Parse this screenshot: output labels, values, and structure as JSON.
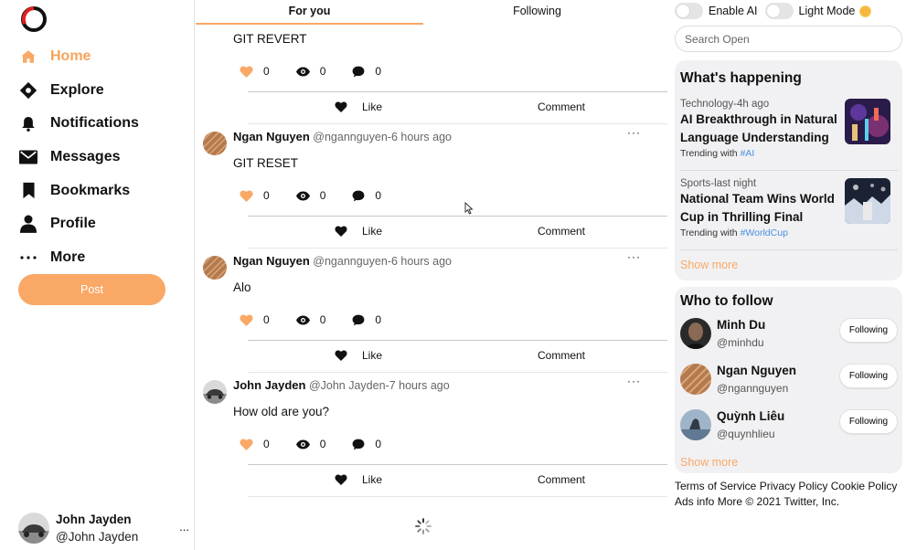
{
  "sidebar": {
    "items": [
      {
        "label": "Home",
        "icon": "home-icon"
      },
      {
        "label": "Explore",
        "icon": "explore-icon"
      },
      {
        "label": "Notifications",
        "icon": "bell-icon"
      },
      {
        "label": "Messages",
        "icon": "envelope-icon"
      },
      {
        "label": "Bookmarks",
        "icon": "bookmark-icon"
      },
      {
        "label": "Profile",
        "icon": "person-icon"
      },
      {
        "label": "More",
        "icon": "more-dots-icon"
      }
    ],
    "post_label": "Post",
    "user": {
      "name": "John Jayden",
      "handle": "@John Jayden",
      "menu": "..."
    }
  },
  "tabs": [
    "For you",
    "Following"
  ],
  "partial_post": {
    "text": "GIT REVERT",
    "likes": "0",
    "views": "0",
    "comments": "0"
  },
  "posts": [
    {
      "name": "Ngan Nguyen",
      "meta": "@ngannguyen-6 hours ago",
      "text": "GIT RESET",
      "likes": "0",
      "views": "0",
      "comments": "0"
    },
    {
      "name": "Ngan Nguyen",
      "meta": "@ngannguyen-6 hours ago",
      "text": "Alo",
      "likes": "0",
      "views": "0",
      "comments": "0"
    },
    {
      "name": "John Jayden",
      "meta": "@John Jayden-7 hours ago",
      "text": "How old are you?",
      "likes": "0",
      "views": "0",
      "comments": "0"
    }
  ],
  "post_actions": {
    "like": "Like",
    "comment": "Comment",
    "more": "···"
  },
  "right": {
    "toggles": {
      "ai": "Enable AI",
      "light": "Light Mode"
    },
    "search_placeholder": "Search Open",
    "happening": {
      "title": "What's happening",
      "trends": [
        {
          "meta": "Technology-4h ago",
          "title": "AI Breakthrough in Natural Language Understanding",
          "trending_prefix": "Trending with",
          "tag": "#AI"
        },
        {
          "meta": "Sports-last night",
          "title": "National Team Wins World Cup in Thrilling Final",
          "trending_prefix": "Trending with",
          "tag": "#WorldCup"
        }
      ],
      "show_more": "Show more"
    },
    "who_to_follow": {
      "title": "Who to follow",
      "users": [
        {
          "name": "Minh Du",
          "handle": "@minhdu",
          "button": "Following"
        },
        {
          "name": "Ngan Nguyen",
          "handle": "@ngannguyen",
          "button": "Following"
        },
        {
          "name": "Quỳnh Liêu",
          "handle": "@quynhlieu",
          "button": "Following"
        }
      ],
      "show_more": "Show more"
    },
    "footer": {
      "line1": "Terms of Service Privacy Policy Cookie Policy",
      "line2": "Ads info More © 2021 Twitter, Inc."
    }
  },
  "colors": {
    "accent": "#f9a866",
    "link": "#4a8fe0"
  }
}
